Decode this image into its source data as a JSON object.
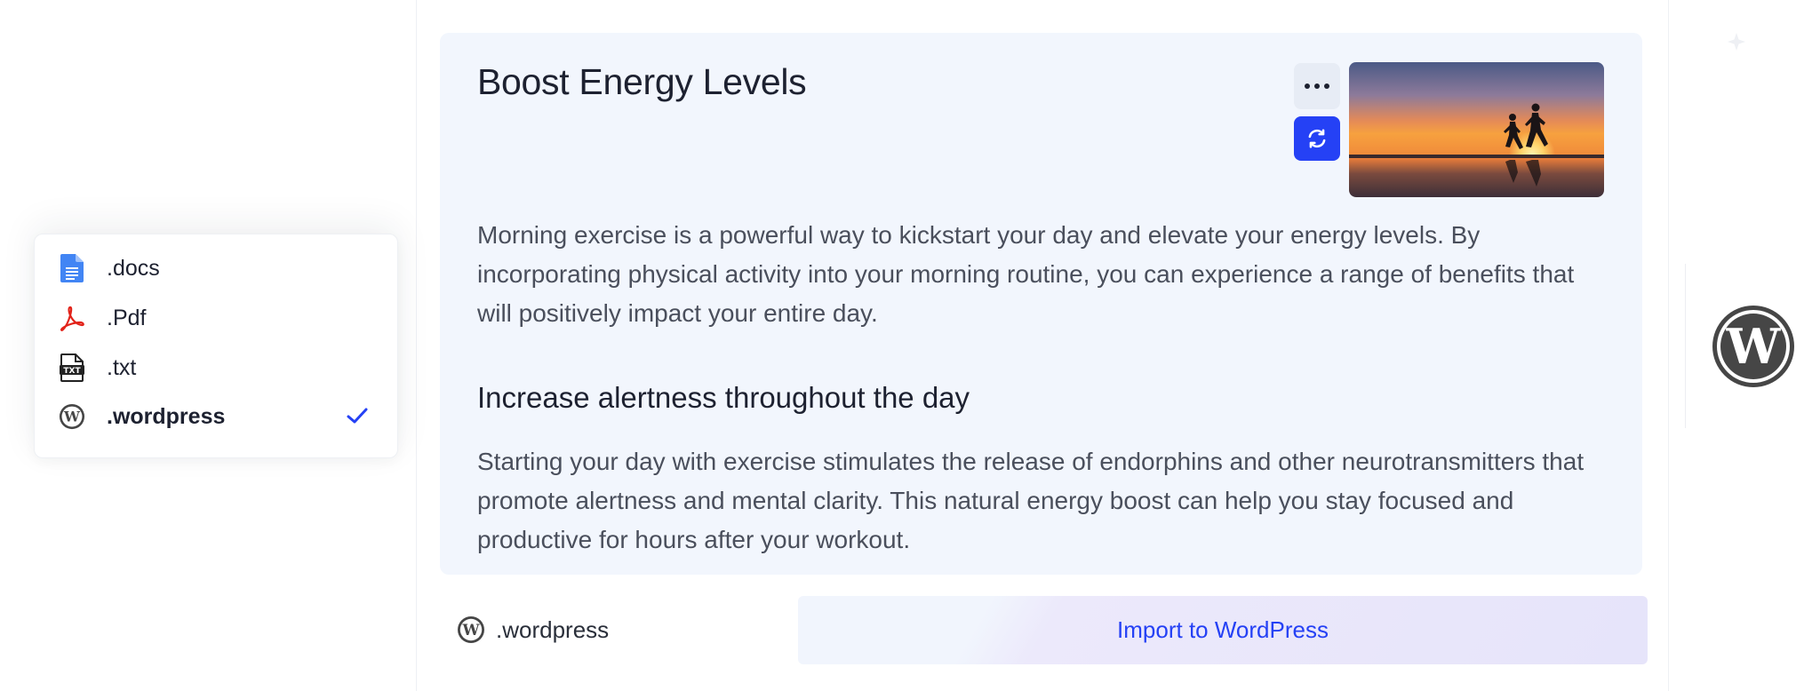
{
  "article": {
    "title": "Boost Energy Levels",
    "paragraph1": "Morning exercise is a powerful way to kickstart your day and elevate your energy levels. By incorporating physical activity into your morning routine, you can experience a range of benefits that will positively impact your entire day.",
    "subheading": "Increase alertness throughout the day",
    "paragraph2": "Starting your day with exercise stimulates the release of endorphins and other neurotransmitters that promote alertness and mental clarity. This natural energy boost can help you stay focused and productive for hours after your workout.",
    "more_icon": "more-horizontal-icon",
    "refresh_icon": "refresh-icon",
    "image": "sunset-runners-photo"
  },
  "format_menu": {
    "items": [
      {
        "label": ".docs",
        "icon": "google-docs-icon",
        "selected": false
      },
      {
        "label": ".Pdf",
        "icon": "pdf-icon",
        "selected": false
      },
      {
        "label": ".txt",
        "icon": "txt-file-icon",
        "selected": false
      },
      {
        "label": ".wordpress",
        "icon": "wordpress-icon",
        "selected": true
      }
    ],
    "check_icon": "checkmark-icon"
  },
  "footer": {
    "selected_format": ".wordpress",
    "import_button": "Import to WordPress"
  },
  "colors": {
    "accent": "#2541f5",
    "article_bg": "#f2f6fd",
    "text_primary": "#1d2130",
    "text_body": "#4a4f5c"
  }
}
